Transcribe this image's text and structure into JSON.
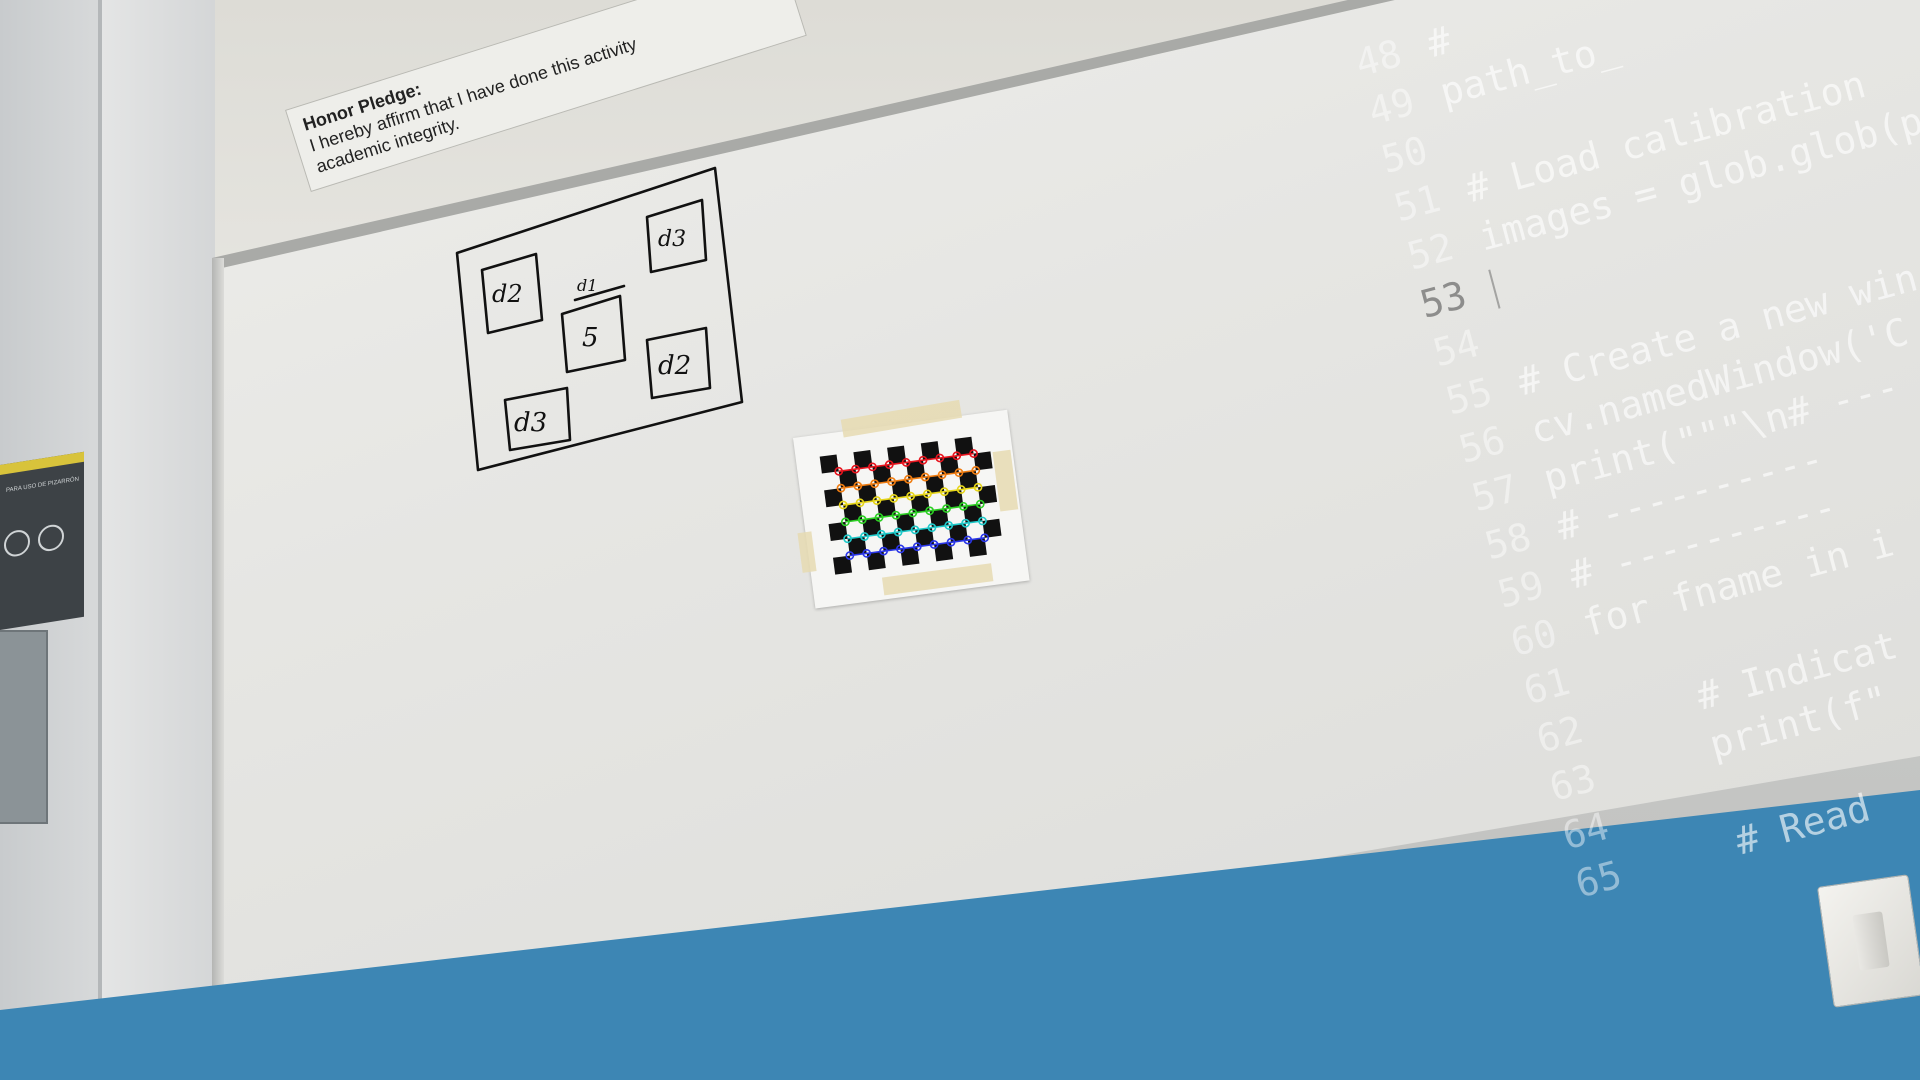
{
  "plaque": {
    "title": "Honor Pledge:",
    "line1": "I hereby affirm that I have done this activity",
    "line2": "academic integrity."
  },
  "drawing": {
    "labels": [
      "d2",
      "d1",
      "5",
      "d3",
      "d2",
      "d3"
    ]
  },
  "code_lines": [
    {
      "num": "48",
      "text": "# "
    },
    {
      "num": "49",
      "text": "path_to_"
    },
    {
      "num": "50",
      "text": ""
    },
    {
      "num": "51",
      "text": "# Load calibration"
    },
    {
      "num": "52",
      "text": "images = glob.glob(p"
    },
    {
      "num": "53",
      "text": ""
    },
    {
      "num": "54",
      "text": ""
    },
    {
      "num": "55",
      "text": "# Create a new win"
    },
    {
      "num": "56",
      "text": "cv.namedWindow('C"
    },
    {
      "num": "57",
      "text": "print(\"\"\"\\n# ---"
    },
    {
      "num": "58",
      "text": "# ----------"
    },
    {
      "num": "59",
      "text": "# ----------"
    },
    {
      "num": "60",
      "text": "for fname in i"
    },
    {
      "num": "61",
      "text": ""
    },
    {
      "num": "62",
      "text": "    # Indicat"
    },
    {
      "num": "63",
      "text": "    print(f\""
    },
    {
      "num": "64",
      "text": ""
    },
    {
      "num": "65",
      "text": "    # Read"
    }
  ],
  "poster": {
    "title": "PARA USO DE PIZARRÓN"
  },
  "colors": {
    "blue_wall": "#3d86b4",
    "board": "#e6e6e3",
    "corner_rows": [
      "#e8141e",
      "#f07d12",
      "#e6d51a",
      "#2ccf23",
      "#1ec9c9",
      "#2a36e8"
    ]
  }
}
